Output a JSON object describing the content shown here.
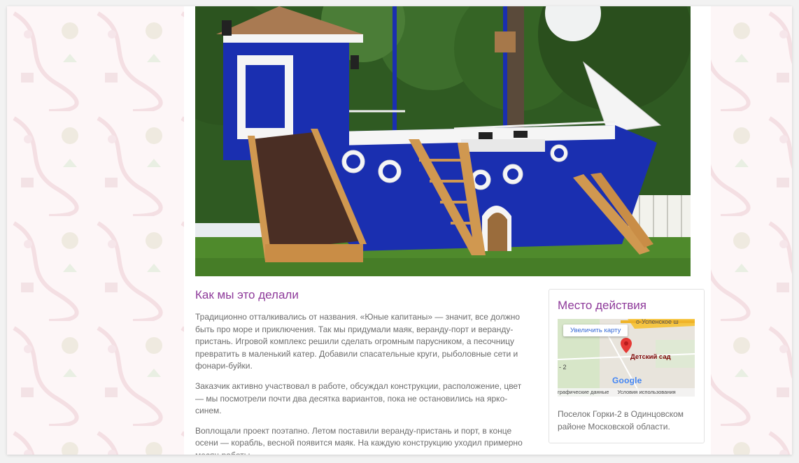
{
  "hero": {
    "image": "ship-playground-photo"
  },
  "article": {
    "title": "Как мы это делали",
    "paragraphs": [
      "Традиционно отталкивались от названия. «Юные капитаны» — значит, все должно быть про море и приключения. Так мы придумали маяк, веранду-порт и веранду-пристань. Игровой комплекс решили сделать огромным парусником, а песочницу превратить в маленький катер. Добавили спасательные круги, рыболовные сети и фонари-буйки.",
      "Заказчик активно участвовал в работе, обсуждал конструкции, расположение, цвет — мы посмотрели почти два десятка вариантов, пока не остановились на ярко-синем.",
      "Воплощали проект поэтапно. Летом поставили веранду-пристань и порт, в конце осени — корабль, весной появится маяк. На каждую конструкцию уходил примерно месяц работы."
    ]
  },
  "location": {
    "title": "Место действия",
    "map": {
      "enlarge_button": "Увеличить карту",
      "street_label": "о-Успенское ш",
      "pin_label": "Детский сад",
      "scale_fragment": "- 2",
      "provider": "Google",
      "footer_data": "графические данные",
      "footer_terms": "Условия использования"
    },
    "address": "Поселок Горки-2 в Одинцовском районе Московской области."
  },
  "colors": {
    "accent": "#8e3a9a",
    "text": "#6d6d6d",
    "ship_blue": "#1a2fb0"
  }
}
